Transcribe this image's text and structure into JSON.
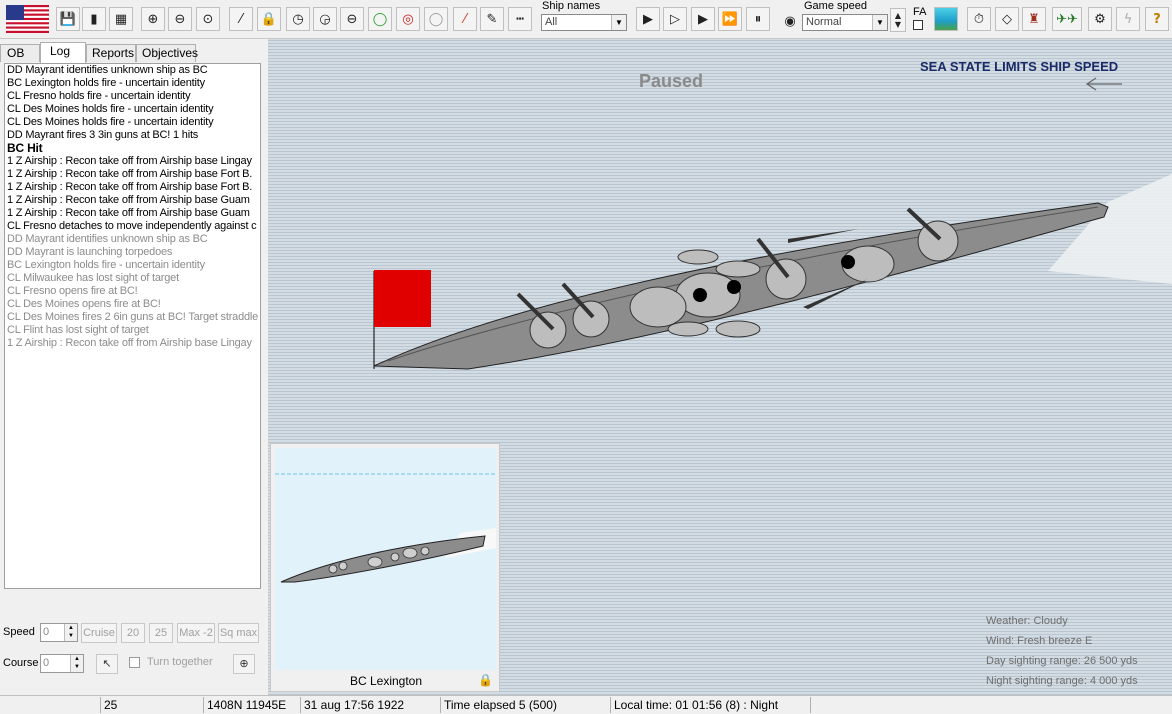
{
  "toolbar": {
    "ship_names_label": "Ship names",
    "ship_names_value": "All",
    "game_speed_label": "Game speed",
    "game_speed_value": "Normal",
    "fa_label": "FA"
  },
  "tabs": [
    {
      "label": "OB"
    },
    {
      "label": "Log"
    },
    {
      "label": "Reports"
    },
    {
      "label": "Objectives"
    }
  ],
  "log": [
    {
      "text": "DD Mayrant identifies unknown ship as BC",
      "style": "normal"
    },
    {
      "text": "BC Lexington holds fire - uncertain identity",
      "style": "normal"
    },
    {
      "text": "CL Fresno holds fire - uncertain identity",
      "style": "normal"
    },
    {
      "text": "CL Des Moines holds fire - uncertain identity",
      "style": "normal"
    },
    {
      "text": "CL Des Moines holds fire - uncertain identity",
      "style": "normal"
    },
    {
      "text": "DD Mayrant fires 3 3in guns at BC! 1 hits",
      "style": "normal"
    },
    {
      "text": "BC Hit",
      "style": "bold"
    },
    {
      "text": "1 Z  Airship : Recon take off from Airship base Lingay",
      "style": "normal"
    },
    {
      "text": "1 Z  Airship : Recon take off from Airship base Fort B.",
      "style": "normal"
    },
    {
      "text": "1 Z  Airship : Recon take off from Airship base Fort B.",
      "style": "normal"
    },
    {
      "text": "1 Z  Airship : Recon take off from Airship base Guam",
      "style": "normal"
    },
    {
      "text": "1 Z  Airship : Recon take off from Airship base Guam",
      "style": "normal"
    },
    {
      "text": "CL Fresno detaches to move independently against c",
      "style": "normal"
    },
    {
      "text": "DD Mayrant identifies unknown ship as BC",
      "style": "grey"
    },
    {
      "text": "DD Mayrant is launching torpedoes",
      "style": "grey"
    },
    {
      "text": "BC Lexington holds fire - uncertain identity",
      "style": "grey"
    },
    {
      "text": "CL Milwaukee has lost sight of target",
      "style": "grey"
    },
    {
      "text": "CL Fresno opens fire at BC!",
      "style": "grey"
    },
    {
      "text": "CL Des Moines opens fire at BC!",
      "style": "grey"
    },
    {
      "text": "CL Des Moines fires 2 6in guns at BC! Target straddle",
      "style": "grey"
    },
    {
      "text": "CL Flint has lost sight of target",
      "style": "grey"
    },
    {
      "text": "1 Z  Airship : Recon take off from Airship base Lingay",
      "style": "grey"
    }
  ],
  "controls": {
    "speed_label": "Speed",
    "speed_value": "0",
    "cruise_label": "Cruise",
    "s20_label": "20",
    "s25_label": "25",
    "max2_label": "Max -2",
    "sqmax_label": "Sq max",
    "course_label": "Course",
    "course_value": "0",
    "turn_together_label": "Turn together"
  },
  "map": {
    "paused": "Paused",
    "sea_state": "SEA STATE LIMITS SHIP SPEED",
    "weather": "Weather: Cloudy",
    "wind": "Wind: Fresh breeze  E",
    "day_range": "Day sighting range: 26 500 yds",
    "night_range": "Night sighting range: 4 000 yds"
  },
  "preview": {
    "ship_name": "BC Lexington"
  },
  "status": {
    "c1": "25",
    "c2": "1408N 11945E",
    "c3": "31 aug 17:56 1922",
    "c4": "Time elapsed 5 (500)",
    "c5": "Local time: 01 01:56 (8) : Night"
  },
  "colors": {
    "flag_marker": "#e00000",
    "sea": "#c7d2db",
    "hull": "#8c8c8c"
  }
}
